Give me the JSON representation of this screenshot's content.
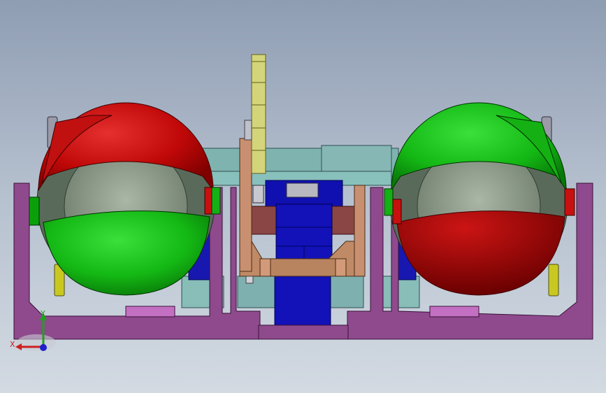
{
  "view": {
    "background_top": "#8f9db3",
    "background_bottom": "#d3dae2"
  },
  "colors": {
    "frame": "#8e4a8c",
    "frame_light": "#c470c2",
    "red": "#c81010",
    "red_dark": "#7a0000",
    "green": "#17c017",
    "green_dark": "#0a7a0a",
    "blue": "#1010b0",
    "teal": "#7fb0b0",
    "tan": "#c08a66",
    "olive": "#d8d880",
    "gray_glass": "#9aa89a"
  },
  "parts": {
    "left_eye": "left-eyeball-assembly",
    "right_eye": "right-eyeball-assembly",
    "center": "center-mechanism",
    "base": "base-frame",
    "gear": "gear-rack"
  },
  "triad": {
    "x_label": "X",
    "y_label": "Y",
    "x_color": "#cc2020",
    "y_color": "#20a020",
    "z_color": "#2020cc"
  }
}
